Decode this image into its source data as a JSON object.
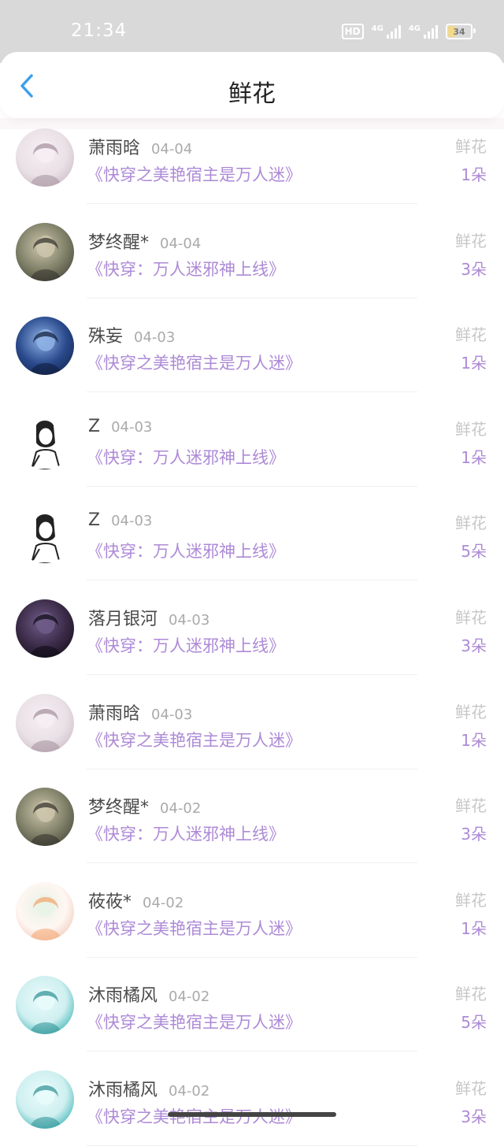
{
  "status": {
    "time": "21:34",
    "hd": "HD",
    "net1": "4G",
    "net2": "4G",
    "battery": "34"
  },
  "header": {
    "title": "鲜花",
    "back_icon": "chevron-left-icon"
  },
  "colors": {
    "accent": "#ad8ad6",
    "back": "#3ca0ee"
  },
  "records": [
    {
      "name": "萧雨晗",
      "date": "04-04",
      "book": "《快穿之美艳宿主是万人迷》",
      "gift": "鲜花",
      "count": "1朵",
      "avatar": "avatar-girl-light"
    },
    {
      "name": "梦终醒*",
      "date": "04-04",
      "book": "《快穿：万人迷邪神上线》",
      "gift": "鲜花",
      "count": "3朵",
      "avatar": "avatar-anime-sepia"
    },
    {
      "name": "殊妄",
      "date": "04-03",
      "book": "《快穿之美艳宿主是万人迷》",
      "gift": "鲜花",
      "count": "1朵",
      "avatar": "avatar-girl-blue"
    },
    {
      "name": "Z",
      "date": "04-03",
      "book": "《快穿：万人迷邪神上线》",
      "gift": "鲜花",
      "count": "1朵",
      "avatar": "avatar-sketch"
    },
    {
      "name": "Z",
      "date": "04-03",
      "book": "《快穿：万人迷邪神上线》",
      "gift": "鲜花",
      "count": "5朵",
      "avatar": "avatar-sketch"
    },
    {
      "name": "落月银河",
      "date": "04-03",
      "book": "《快穿：万人迷邪神上线》",
      "gift": "鲜花",
      "count": "3朵",
      "avatar": "avatar-dark-night"
    },
    {
      "name": "萧雨晗",
      "date": "04-03",
      "book": "《快穿之美艳宿主是万人迷》",
      "gift": "鲜花",
      "count": "1朵",
      "avatar": "avatar-girl-light"
    },
    {
      "name": "梦终醒*",
      "date": "04-02",
      "book": "《快穿：万人迷邪神上线》",
      "gift": "鲜花",
      "count": "3朵",
      "avatar": "avatar-anime-sepia"
    },
    {
      "name": "莜莜*",
      "date": "04-02",
      "book": "《快穿之美艳宿主是万人迷》",
      "gift": "鲜花",
      "count": "1朵",
      "avatar": "avatar-pastel"
    },
    {
      "name": "沐雨橘风",
      "date": "04-02",
      "book": "《快穿之美艳宿主是万人迷》",
      "gift": "鲜花",
      "count": "5朵",
      "avatar": "avatar-teal"
    },
    {
      "name": "沐雨橘风",
      "date": "04-02",
      "book": "《快穿之美艳宿主是万人迷》",
      "gift": "鲜花",
      "count": "3朵",
      "avatar": "avatar-teal"
    }
  ]
}
